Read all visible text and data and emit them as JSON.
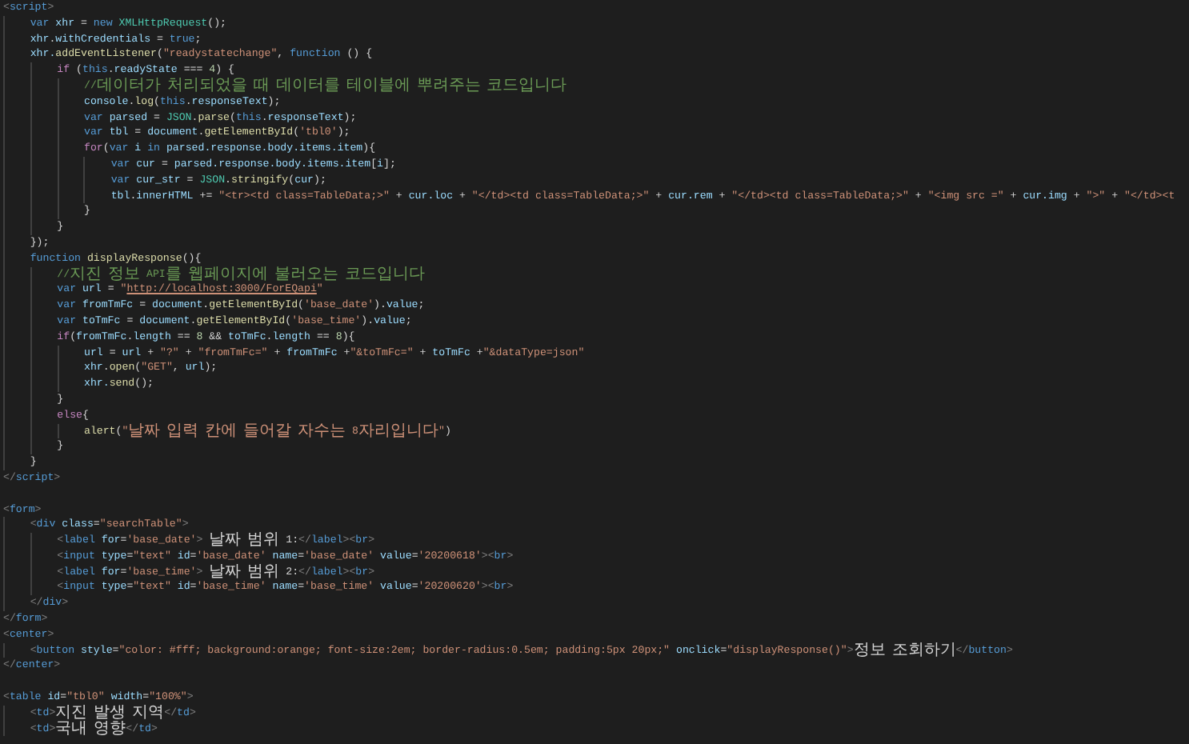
{
  "editor": {
    "lines": [
      {
        "kind": "code",
        "tokens": [
          {
            "kind": "punct",
            "text": "<"
          },
          {
            "kind": "tag",
            "text": "script"
          },
          {
            "kind": "punct",
            "text": ">"
          }
        ]
      },
      {
        "kind": "code",
        "tokens": [
          {
            "kind": "kw",
            "text": "    var "
          },
          {
            "kind": "var",
            "text": "xhr"
          },
          {
            "kind": "plain",
            "text": " = "
          },
          {
            "kind": "kw",
            "text": "new "
          },
          {
            "kind": "cls",
            "text": "XMLHttpRequest"
          },
          {
            "kind": "plain",
            "text": "();"
          }
        ]
      },
      {
        "kind": "code",
        "tokens": [
          {
            "kind": "var",
            "text": "    xhr"
          },
          {
            "kind": "plain",
            "text": "."
          },
          {
            "kind": "var",
            "text": "withCredentials"
          },
          {
            "kind": "plain",
            "text": " = "
          },
          {
            "kind": "kw",
            "text": "true"
          },
          {
            "kind": "plain",
            "text": ";"
          }
        ]
      },
      {
        "kind": "code",
        "tokens": [
          {
            "kind": "var",
            "text": "    xhr."
          },
          {
            "kind": "fn",
            "text": "addEventListener"
          },
          {
            "kind": "plain",
            "text": "("
          },
          {
            "kind": "str",
            "text": "\"readystatechange\""
          },
          {
            "kind": "plain",
            "text": ", "
          },
          {
            "kind": "kw",
            "text": "function"
          },
          {
            "kind": "plain",
            "text": " () {"
          }
        ]
      },
      {
        "kind": "code",
        "tokens": [
          {
            "kind": "ctrl",
            "text": "        if"
          },
          {
            "kind": "plain",
            "text": " ("
          },
          {
            "kind": "kw",
            "text": "this"
          },
          {
            "kind": "plain",
            "text": "."
          },
          {
            "kind": "var",
            "text": "readyState"
          },
          {
            "kind": "plain",
            "text": " === "
          },
          {
            "kind": "num",
            "text": "4"
          },
          {
            "kind": "plain",
            "text": ") {"
          }
        ]
      },
      {
        "kind": "code",
        "tokens": [
          {
            "kind": "comment",
            "text": "            //데이터가 처리되었을 때 데이터를 테이블에 뿌려주는 코드입니다"
          }
        ]
      },
      {
        "kind": "code",
        "tokens": [
          {
            "kind": "var",
            "text": "            console"
          },
          {
            "kind": "plain",
            "text": "."
          },
          {
            "kind": "fn",
            "text": "log"
          },
          {
            "kind": "plain",
            "text": "("
          },
          {
            "kind": "kw",
            "text": "this"
          },
          {
            "kind": "plain",
            "text": "."
          },
          {
            "kind": "var",
            "text": "responseText"
          },
          {
            "kind": "plain",
            "text": ");"
          }
        ]
      },
      {
        "kind": "code",
        "tokens": [
          {
            "kind": "kw",
            "text": "            var "
          },
          {
            "kind": "var",
            "text": "parsed"
          },
          {
            "kind": "plain",
            "text": " = "
          },
          {
            "kind": "cls",
            "text": "JSON"
          },
          {
            "kind": "plain",
            "text": "."
          },
          {
            "kind": "fn",
            "text": "parse"
          },
          {
            "kind": "plain",
            "text": "("
          },
          {
            "kind": "kw",
            "text": "this"
          },
          {
            "kind": "plain",
            "text": "."
          },
          {
            "kind": "var",
            "text": "responseText"
          },
          {
            "kind": "plain",
            "text": ");"
          }
        ]
      },
      {
        "kind": "code",
        "tokens": [
          {
            "kind": "kw",
            "text": "            var "
          },
          {
            "kind": "var",
            "text": "tbl"
          },
          {
            "kind": "plain",
            "text": " = "
          },
          {
            "kind": "var",
            "text": "document"
          },
          {
            "kind": "plain",
            "text": "."
          },
          {
            "kind": "fn",
            "text": "getElementById"
          },
          {
            "kind": "plain",
            "text": "("
          },
          {
            "kind": "str",
            "text": "'tbl0'"
          },
          {
            "kind": "plain",
            "text": ");"
          }
        ]
      },
      {
        "kind": "code",
        "tokens": [
          {
            "kind": "ctrl",
            "text": "            for"
          },
          {
            "kind": "plain",
            "text": "("
          },
          {
            "kind": "kw",
            "text": "var "
          },
          {
            "kind": "var",
            "text": "i "
          },
          {
            "kind": "kw",
            "text": "in "
          },
          {
            "kind": "var",
            "text": "parsed.response.body.items.item"
          },
          {
            "kind": "plain",
            "text": "){"
          }
        ]
      },
      {
        "kind": "code",
        "tokens": [
          {
            "kind": "kw",
            "text": "                var "
          },
          {
            "kind": "var",
            "text": "cur"
          },
          {
            "kind": "plain",
            "text": " = "
          },
          {
            "kind": "var",
            "text": "parsed.response.body.items.item"
          },
          {
            "kind": "plain",
            "text": "["
          },
          {
            "kind": "var",
            "text": "i"
          },
          {
            "kind": "plain",
            "text": "];"
          }
        ]
      },
      {
        "kind": "code",
        "tokens": [
          {
            "kind": "kw",
            "text": "                var "
          },
          {
            "kind": "var",
            "text": "cur_str"
          },
          {
            "kind": "plain",
            "text": " = "
          },
          {
            "kind": "cls",
            "text": "JSON"
          },
          {
            "kind": "plain",
            "text": "."
          },
          {
            "kind": "fn",
            "text": "stringify"
          },
          {
            "kind": "plain",
            "text": "("
          },
          {
            "kind": "var",
            "text": "cur"
          },
          {
            "kind": "plain",
            "text": ");"
          }
        ]
      },
      {
        "kind": "code",
        "tokens": [
          {
            "kind": "var",
            "text": "                tbl"
          },
          {
            "kind": "plain",
            "text": "."
          },
          {
            "kind": "var",
            "text": "innerHTML"
          },
          {
            "kind": "plain",
            "text": " += "
          },
          {
            "kind": "str",
            "text": "\"<tr><td class=TableData;>\""
          },
          {
            "kind": "plain",
            "text": " + "
          },
          {
            "kind": "var",
            "text": "cur.loc"
          },
          {
            "kind": "plain",
            "text": " + "
          },
          {
            "kind": "str",
            "text": "\"</td><td class=TableData;>\""
          },
          {
            "kind": "plain",
            "text": " + "
          },
          {
            "kind": "var",
            "text": "cur.rem"
          },
          {
            "kind": "plain",
            "text": " + "
          },
          {
            "kind": "str",
            "text": "\"</td><td class=TableData;>\""
          },
          {
            "kind": "plain",
            "text": " + "
          },
          {
            "kind": "str",
            "text": "\"<img src =\""
          },
          {
            "kind": "plain",
            "text": " + "
          },
          {
            "kind": "var",
            "text": "cur.img"
          },
          {
            "kind": "plain",
            "text": " + "
          },
          {
            "kind": "str",
            "text": "\">\""
          },
          {
            "kind": "plain",
            "text": " + "
          },
          {
            "kind": "str",
            "text": "\"</td><t"
          }
        ]
      },
      {
        "kind": "code",
        "tokens": [
          {
            "kind": "plain",
            "text": "            }"
          }
        ]
      },
      {
        "kind": "code",
        "tokens": [
          {
            "kind": "plain",
            "text": "        }"
          }
        ]
      },
      {
        "kind": "code",
        "tokens": [
          {
            "kind": "plain",
            "text": "    });"
          }
        ]
      },
      {
        "kind": "code",
        "tokens": [
          {
            "kind": "kw",
            "text": "    function "
          },
          {
            "kind": "fn",
            "text": "displayResponse"
          },
          {
            "kind": "plain",
            "text": "(){"
          }
        ]
      },
      {
        "kind": "code",
        "tokens": [
          {
            "kind": "comment",
            "text": "        //지진 정보 API를 웹페이지에 불러오는 코드입니다"
          }
        ]
      },
      {
        "kind": "code",
        "tokens": [
          {
            "kind": "kw",
            "text": "        var "
          },
          {
            "kind": "var",
            "text": "url"
          },
          {
            "kind": "plain",
            "text": " = "
          },
          {
            "kind": "str",
            "text": "\""
          },
          {
            "kind": "link",
            "text": "http://localhost:3000/ForEQapi"
          },
          {
            "kind": "str",
            "text": "\""
          }
        ]
      },
      {
        "kind": "code",
        "tokens": [
          {
            "kind": "kw",
            "text": "        var "
          },
          {
            "kind": "var",
            "text": "fromTmFc"
          },
          {
            "kind": "plain",
            "text": " = "
          },
          {
            "kind": "var",
            "text": "document"
          },
          {
            "kind": "plain",
            "text": "."
          },
          {
            "kind": "fn",
            "text": "getElementById"
          },
          {
            "kind": "plain",
            "text": "("
          },
          {
            "kind": "str",
            "text": "'base_date'"
          },
          {
            "kind": "plain",
            "text": ")."
          },
          {
            "kind": "var",
            "text": "value"
          },
          {
            "kind": "plain",
            "text": ";"
          }
        ]
      },
      {
        "kind": "code",
        "tokens": [
          {
            "kind": "kw",
            "text": "        var "
          },
          {
            "kind": "var",
            "text": "toTmFc"
          },
          {
            "kind": "plain",
            "text": " = "
          },
          {
            "kind": "var",
            "text": "document"
          },
          {
            "kind": "plain",
            "text": "."
          },
          {
            "kind": "fn",
            "text": "getElementById"
          },
          {
            "kind": "plain",
            "text": "("
          },
          {
            "kind": "str",
            "text": "'base_time'"
          },
          {
            "kind": "plain",
            "text": ")."
          },
          {
            "kind": "var",
            "text": "value"
          },
          {
            "kind": "plain",
            "text": ";"
          }
        ]
      },
      {
        "kind": "code",
        "tokens": [
          {
            "kind": "ctrl",
            "text": "        if"
          },
          {
            "kind": "plain",
            "text": "("
          },
          {
            "kind": "var",
            "text": "fromTmFc"
          },
          {
            "kind": "plain",
            "text": "."
          },
          {
            "kind": "var",
            "text": "length"
          },
          {
            "kind": "plain",
            "text": " == "
          },
          {
            "kind": "num",
            "text": "8"
          },
          {
            "kind": "plain",
            "text": " && "
          },
          {
            "kind": "var",
            "text": "toTmFc"
          },
          {
            "kind": "plain",
            "text": "."
          },
          {
            "kind": "var",
            "text": "length"
          },
          {
            "kind": "plain",
            "text": " == "
          },
          {
            "kind": "num",
            "text": "8"
          },
          {
            "kind": "plain",
            "text": "){"
          }
        ]
      },
      {
        "kind": "code",
        "tokens": [
          {
            "kind": "var",
            "text": "            url"
          },
          {
            "kind": "plain",
            "text": " = "
          },
          {
            "kind": "var",
            "text": "url"
          },
          {
            "kind": "plain",
            "text": " + "
          },
          {
            "kind": "str",
            "text": "\"?\""
          },
          {
            "kind": "plain",
            "text": " + "
          },
          {
            "kind": "str",
            "text": "\"fromTmFc=\""
          },
          {
            "kind": "plain",
            "text": " + "
          },
          {
            "kind": "var",
            "text": "fromTmFc"
          },
          {
            "kind": "plain",
            "text": " +"
          },
          {
            "kind": "str",
            "text": "\"&toTmFc=\""
          },
          {
            "kind": "plain",
            "text": " + "
          },
          {
            "kind": "var",
            "text": "toTmFc"
          },
          {
            "kind": "plain",
            "text": " +"
          },
          {
            "kind": "str",
            "text": "\"&dataType=json\""
          }
        ]
      },
      {
        "kind": "code",
        "tokens": [
          {
            "kind": "var",
            "text": "            xhr"
          },
          {
            "kind": "plain",
            "text": "."
          },
          {
            "kind": "fn",
            "text": "open"
          },
          {
            "kind": "plain",
            "text": "("
          },
          {
            "kind": "str",
            "text": "\"GET\""
          },
          {
            "kind": "plain",
            "text": ", "
          },
          {
            "kind": "var",
            "text": "url"
          },
          {
            "kind": "plain",
            "text": ");"
          }
        ]
      },
      {
        "kind": "code",
        "tokens": [
          {
            "kind": "var",
            "text": "            xhr."
          },
          {
            "kind": "fn",
            "text": "send"
          },
          {
            "kind": "plain",
            "text": "();"
          }
        ]
      },
      {
        "kind": "code",
        "tokens": [
          {
            "kind": "plain",
            "text": "        }"
          }
        ]
      },
      {
        "kind": "code",
        "tokens": [
          {
            "kind": "ctrl",
            "text": "        else"
          },
          {
            "kind": "plain",
            "text": "{"
          }
        ]
      },
      {
        "kind": "code",
        "tokens": [
          {
            "kind": "fn",
            "text": "            alert"
          },
          {
            "kind": "plain",
            "text": "("
          },
          {
            "kind": "str",
            "text": "\"날짜 입력 칸에 들어갈 자수는 8자리입니다\""
          },
          {
            "kind": "plain",
            "text": ")"
          }
        ]
      },
      {
        "kind": "code",
        "tokens": [
          {
            "kind": "plain",
            "text": "        }"
          }
        ]
      },
      {
        "kind": "code",
        "tokens": [
          {
            "kind": "plain",
            "text": "    }"
          }
        ]
      },
      {
        "kind": "code",
        "tokens": [
          {
            "kind": "punct",
            "text": "</"
          },
          {
            "kind": "tag",
            "text": "script"
          },
          {
            "kind": "punct",
            "text": ">"
          }
        ]
      },
      {
        "kind": "blank"
      },
      {
        "kind": "code",
        "tokens": [
          {
            "kind": "punct",
            "text": "<"
          },
          {
            "kind": "tag",
            "text": "form"
          },
          {
            "kind": "punct",
            "text": ">"
          }
        ]
      },
      {
        "kind": "code",
        "tokens": [
          {
            "kind": "punct",
            "text": "    <"
          },
          {
            "kind": "tag",
            "text": "div "
          },
          {
            "kind": "attr",
            "text": "class"
          },
          {
            "kind": "plain",
            "text": "="
          },
          {
            "kind": "str",
            "text": "\"searchTable\""
          },
          {
            "kind": "punct",
            "text": ">"
          }
        ]
      },
      {
        "kind": "code",
        "tokens": [
          {
            "kind": "punct",
            "text": "        <"
          },
          {
            "kind": "tag",
            "text": "label "
          },
          {
            "kind": "attr",
            "text": "for"
          },
          {
            "kind": "plain",
            "text": "="
          },
          {
            "kind": "str",
            "text": "'base_date'"
          },
          {
            "kind": "punct",
            "text": ">"
          },
          {
            "kind": "plain",
            "text": " 날짜 범위 1:"
          },
          {
            "kind": "punct",
            "text": "</"
          },
          {
            "kind": "tag",
            "text": "label"
          },
          {
            "kind": "punct",
            "text": "><"
          },
          {
            "kind": "tag",
            "text": "br"
          },
          {
            "kind": "punct",
            "text": ">"
          }
        ]
      },
      {
        "kind": "code",
        "tokens": [
          {
            "kind": "punct",
            "text": "        <"
          },
          {
            "kind": "tag",
            "text": "input "
          },
          {
            "kind": "attr",
            "text": "type"
          },
          {
            "kind": "plain",
            "text": "="
          },
          {
            "kind": "str",
            "text": "\"text\" "
          },
          {
            "kind": "attr",
            "text": "id"
          },
          {
            "kind": "plain",
            "text": "="
          },
          {
            "kind": "str",
            "text": "'base_date' "
          },
          {
            "kind": "attr",
            "text": "name"
          },
          {
            "kind": "plain",
            "text": "="
          },
          {
            "kind": "str",
            "text": "'base_date' "
          },
          {
            "kind": "attr",
            "text": "value"
          },
          {
            "kind": "plain",
            "text": "="
          },
          {
            "kind": "str",
            "text": "'20200618'"
          },
          {
            "kind": "punct",
            "text": "><"
          },
          {
            "kind": "tag",
            "text": "br"
          },
          {
            "kind": "punct",
            "text": ">"
          }
        ]
      },
      {
        "kind": "code",
        "tokens": [
          {
            "kind": "punct",
            "text": "        <"
          },
          {
            "kind": "tag",
            "text": "label "
          },
          {
            "kind": "attr",
            "text": "for"
          },
          {
            "kind": "plain",
            "text": "="
          },
          {
            "kind": "str",
            "text": "'base_time'"
          },
          {
            "kind": "punct",
            "text": ">"
          },
          {
            "kind": "plain",
            "text": " 날짜 범위 2:"
          },
          {
            "kind": "punct",
            "text": "</"
          },
          {
            "kind": "tag",
            "text": "label"
          },
          {
            "kind": "punct",
            "text": "><"
          },
          {
            "kind": "tag",
            "text": "br"
          },
          {
            "kind": "punct",
            "text": ">"
          }
        ]
      },
      {
        "kind": "code",
        "tokens": [
          {
            "kind": "punct",
            "text": "        <"
          },
          {
            "kind": "tag",
            "text": "input "
          },
          {
            "kind": "attr",
            "text": "type"
          },
          {
            "kind": "plain",
            "text": "="
          },
          {
            "kind": "str",
            "text": "\"text\" "
          },
          {
            "kind": "attr",
            "text": "id"
          },
          {
            "kind": "plain",
            "text": "="
          },
          {
            "kind": "str",
            "text": "'base_time' "
          },
          {
            "kind": "attr",
            "text": "name"
          },
          {
            "kind": "plain",
            "text": "="
          },
          {
            "kind": "str",
            "text": "'base_time' "
          },
          {
            "kind": "attr",
            "text": "value"
          },
          {
            "kind": "plain",
            "text": "="
          },
          {
            "kind": "str",
            "text": "'20200620'"
          },
          {
            "kind": "punct",
            "text": "><"
          },
          {
            "kind": "tag",
            "text": "br"
          },
          {
            "kind": "punct",
            "text": ">"
          }
        ]
      },
      {
        "kind": "code",
        "tokens": [
          {
            "kind": "punct",
            "text": "    </"
          },
          {
            "kind": "tag",
            "text": "div"
          },
          {
            "kind": "punct",
            "text": ">"
          }
        ]
      },
      {
        "kind": "code",
        "tokens": [
          {
            "kind": "punct",
            "text": "</"
          },
          {
            "kind": "tag",
            "text": "form"
          },
          {
            "kind": "punct",
            "text": ">"
          }
        ]
      },
      {
        "kind": "code",
        "tokens": [
          {
            "kind": "punct",
            "text": "<"
          },
          {
            "kind": "tag",
            "text": "center"
          },
          {
            "kind": "punct",
            "text": ">"
          }
        ]
      },
      {
        "kind": "code",
        "tokens": [
          {
            "kind": "punct",
            "text": "    <"
          },
          {
            "kind": "tag",
            "text": "button "
          },
          {
            "kind": "attr",
            "text": "style"
          },
          {
            "kind": "plain",
            "text": "="
          },
          {
            "kind": "str",
            "text": "\"color: #fff; background:orange; font-size:2em; border-radius:0.5em; padding:5px 20px;\" "
          },
          {
            "kind": "attr",
            "text": "onclick"
          },
          {
            "kind": "plain",
            "text": "="
          },
          {
            "kind": "str",
            "text": "\"displayResponse()\""
          },
          {
            "kind": "punct",
            "text": ">"
          },
          {
            "kind": "plain",
            "text": "정보 조회하기"
          },
          {
            "kind": "punct",
            "text": "</"
          },
          {
            "kind": "tag",
            "text": "button"
          },
          {
            "kind": "punct",
            "text": ">"
          }
        ]
      },
      {
        "kind": "code",
        "tokens": [
          {
            "kind": "punct",
            "text": "</"
          },
          {
            "kind": "tag",
            "text": "center"
          },
          {
            "kind": "punct",
            "text": ">"
          }
        ]
      },
      {
        "kind": "blank"
      },
      {
        "kind": "code",
        "tokens": [
          {
            "kind": "punct",
            "text": "<"
          },
          {
            "kind": "tag",
            "text": "table "
          },
          {
            "kind": "attr",
            "text": "id"
          },
          {
            "kind": "plain",
            "text": "="
          },
          {
            "kind": "str",
            "text": "\"tbl0\" "
          },
          {
            "kind": "attr",
            "text": "width"
          },
          {
            "kind": "plain",
            "text": "="
          },
          {
            "kind": "str",
            "text": "\"100%\""
          },
          {
            "kind": "punct",
            "text": ">"
          }
        ]
      },
      {
        "kind": "code",
        "tokens": [
          {
            "kind": "punct",
            "text": "    <"
          },
          {
            "kind": "tag",
            "text": "td"
          },
          {
            "kind": "punct",
            "text": ">"
          },
          {
            "kind": "plain",
            "text": "지진 발생 지역"
          },
          {
            "kind": "punct",
            "text": "</"
          },
          {
            "kind": "tag",
            "text": "td"
          },
          {
            "kind": "punct",
            "text": ">"
          }
        ]
      },
      {
        "kind": "code",
        "tokens": [
          {
            "kind": "punct",
            "text": "    <"
          },
          {
            "kind": "tag",
            "text": "td"
          },
          {
            "kind": "punct",
            "text": ">"
          },
          {
            "kind": "plain",
            "text": "국내 영향"
          },
          {
            "kind": "punct",
            "text": "</"
          },
          {
            "kind": "tag",
            "text": "td"
          },
          {
            "kind": "punct",
            "text": ">"
          }
        ]
      }
    ]
  }
}
